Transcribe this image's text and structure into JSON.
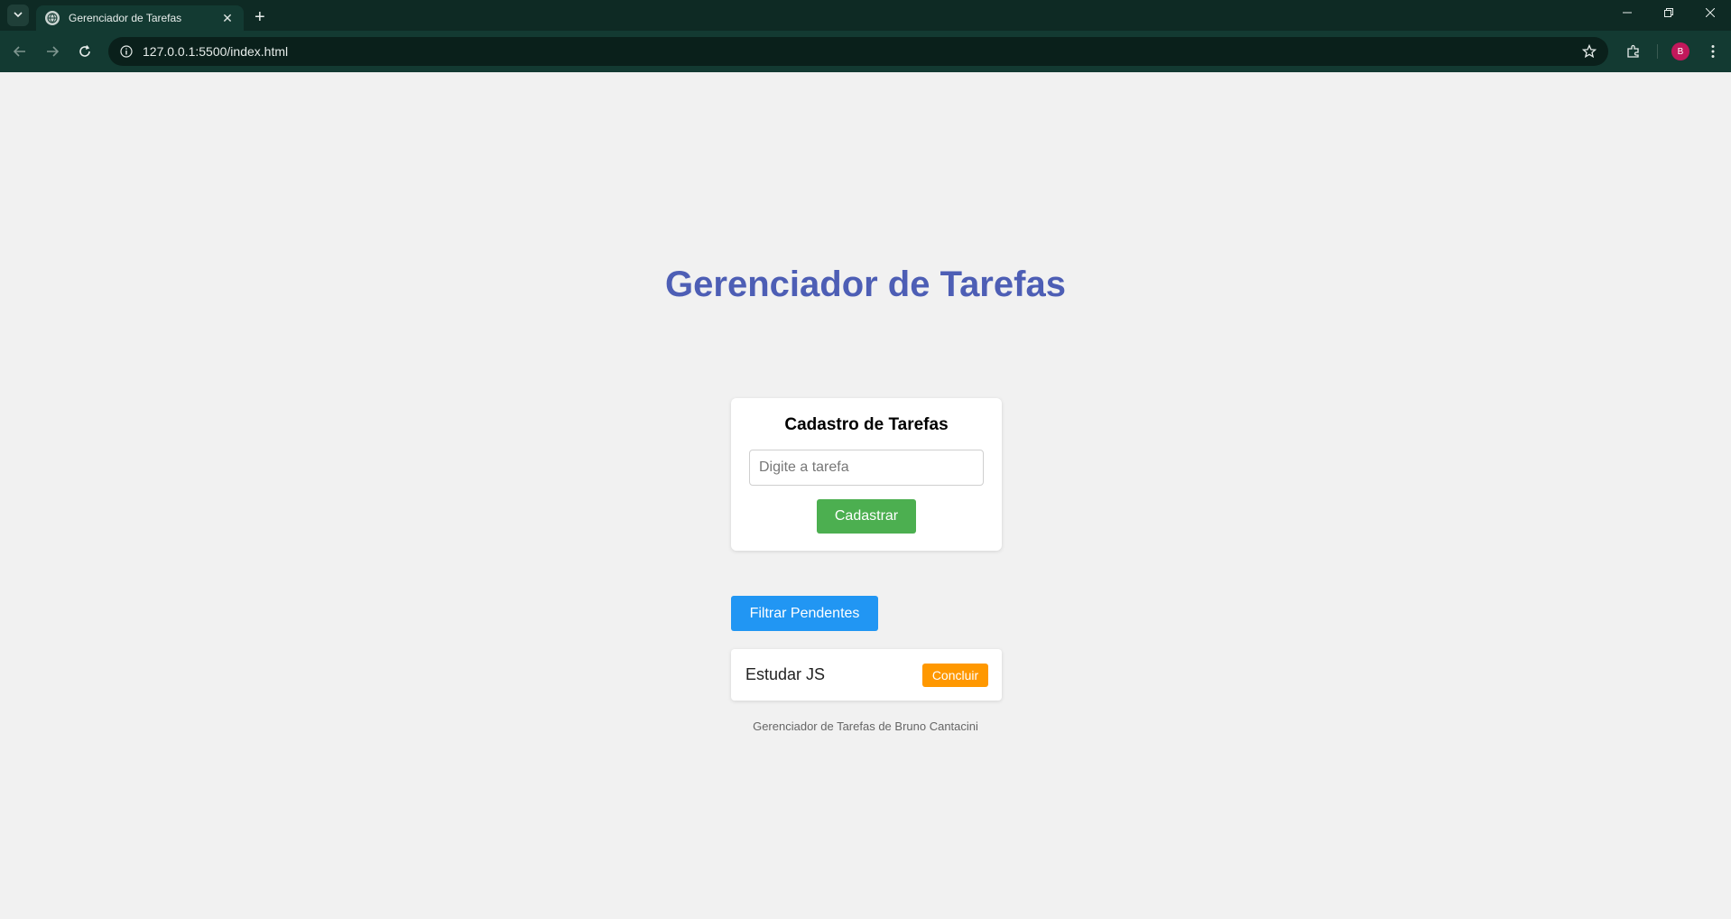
{
  "browser": {
    "tab_title": "Gerenciador de Tarefas",
    "tab_close": "✕",
    "new_tab": "+",
    "url": "127.0.0.1:5500/index.html",
    "avatar_initial": "B",
    "colors": {
      "frame": "#0e2a24",
      "toolbar": "#133a32",
      "avatar": "#c2185b"
    }
  },
  "page": {
    "title": "Gerenciador de Tarefas",
    "form": {
      "heading": "Cadastro de Tarefas",
      "input_placeholder": "Digite a tarefa",
      "input_value": "",
      "submit_label": "Cadastrar"
    },
    "filter_label": "Filtrar Pendentes",
    "tasks": [
      {
        "text": "Estudar JS",
        "action_label": "Concluir"
      }
    ],
    "footer": "Gerenciador de Tarefas de Bruno Cantacini",
    "colors": {
      "background": "#f1f1f1",
      "title": "#4d5eb5",
      "submit": "#4caf50",
      "filter": "#2196f3",
      "complete": "#ff9800"
    }
  }
}
